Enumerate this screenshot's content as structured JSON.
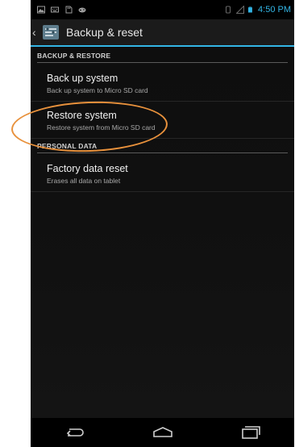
{
  "status_bar": {
    "time": "4:50 PM",
    "left_icons": [
      "gallery-icon",
      "keyboard-icon",
      "sd-card-icon",
      "gamepad-icon"
    ],
    "right_icons": [
      "rotate-icon",
      "signal-icon",
      "battery-icon"
    ]
  },
  "action_bar": {
    "title": "Backup & reset"
  },
  "sections": [
    {
      "header": "BACKUP & RESTORE",
      "items": [
        {
          "title": "Back up system",
          "summary": "Back up system to Micro SD card"
        },
        {
          "title": "Restore system",
          "summary": "Restore system from Micro SD card"
        }
      ]
    },
    {
      "header": "PERSONAL DATA",
      "items": [
        {
          "title": "Factory data reset",
          "summary": "Erases all data on tablet"
        }
      ]
    }
  ],
  "annotation": {
    "color": "#e8913c",
    "target": "Restore system"
  },
  "colors": {
    "accent": "#33b5e5",
    "background": "#000000"
  },
  "nav_bar": {
    "icons": [
      "back-icon",
      "home-icon",
      "recent-apps-icon"
    ]
  }
}
